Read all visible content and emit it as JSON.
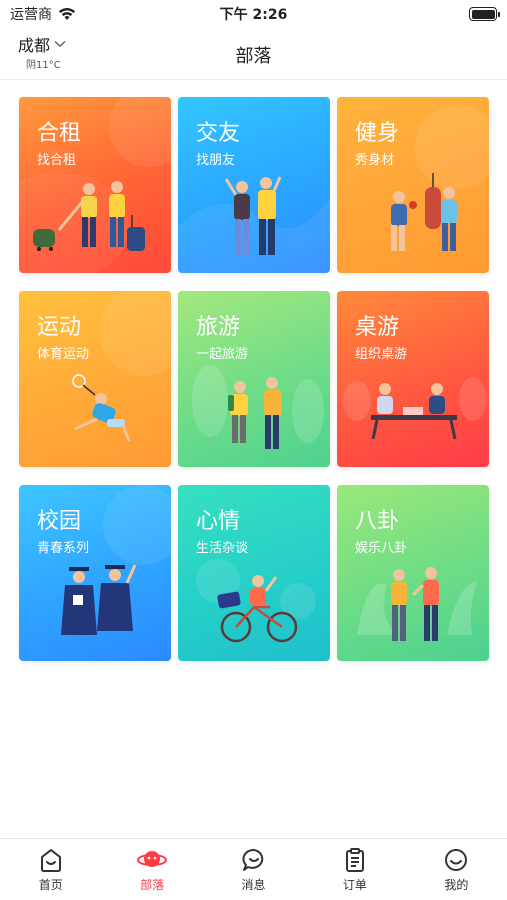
{
  "status_bar": {
    "carrier": "运营商",
    "time": "下午 2:26"
  },
  "nav": {
    "city": "成都",
    "weather": "阴11°C",
    "title": "部落"
  },
  "cards": [
    {
      "title": "合租",
      "subtitle": "找合租"
    },
    {
      "title": "交友",
      "subtitle": "找朋友"
    },
    {
      "title": "健身",
      "subtitle": "秀身材"
    },
    {
      "title": "运动",
      "subtitle": "体育运动"
    },
    {
      "title": "旅游",
      "subtitle": "一起旅游"
    },
    {
      "title": "桌游",
      "subtitle": "组织桌游"
    },
    {
      "title": "校园",
      "subtitle": "青春系列"
    },
    {
      "title": "心情",
      "subtitle": "生活杂谈"
    },
    {
      "title": "八卦",
      "subtitle": "娱乐八卦"
    }
  ],
  "tabs": [
    {
      "label": "首页",
      "icon": "home-face-icon"
    },
    {
      "label": "部落",
      "icon": "tribe-icon"
    },
    {
      "label": "消息",
      "icon": "message-icon"
    },
    {
      "label": "订单",
      "icon": "order-icon"
    },
    {
      "label": "我的",
      "icon": "profile-face-icon"
    }
  ],
  "colors": {
    "accent": "#ff3b45"
  }
}
